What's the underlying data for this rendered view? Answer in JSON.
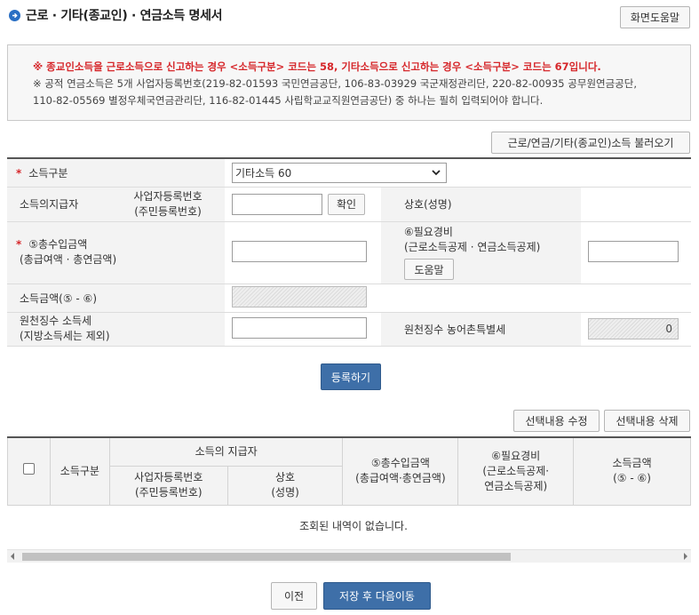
{
  "header": {
    "title": "근로 · 기타(종교인) · 연금소득 명세서",
    "help_button": "화면도움말"
  },
  "notice": {
    "line1": "※ 종교인소득을 근로소득으로 신고하는 경우 <소득구분> 코드는 58, 기타소득으로 신고하는 경우 <소득구분> 코드는 67입니다.",
    "line2": "※ 공적 연금소득은 5개 사업자등록번호(219-82-01593 국민연금공단, 106-83-03929 국군재정관리단, 220-82-00935 공무원연금공단,",
    "line3": "110-82-05569 별정우체국연금관리단, 116-82-01445 사립학교교직원연금공단) 중 하나는 필히 입력되어야 합니다."
  },
  "load_button": "근로/연금/기타(종교인)소득 불러오기",
  "form": {
    "income_type_label": "소득구분",
    "income_type_value": "기타소득 60",
    "payer_label": "소득의지급자",
    "bizno_label_1": "사업자등록번호",
    "bizno_label_2": "(주민등록번호)",
    "bizno_value": "",
    "confirm_button": "확인",
    "company_label": "상호(성명)",
    "company_value": "",
    "gross_label_1": "⑤총수입금액",
    "gross_label_2": "(총급여액 · 총연금액)",
    "gross_value": "",
    "expense_label_1": "⑥필요경비",
    "expense_label_2": "(근로소득공제 · 연금소득공제)",
    "expense_help_button": "도움말",
    "expense_value": "",
    "income_amount_label": "소득금액(⑤ - ⑥)",
    "income_amount_value": "",
    "withholding_label_1": "원천징수 소득세",
    "withholding_label_2": "(지방소득세는 제외)",
    "withholding_value": "",
    "rural_tax_label": "원천징수 농어촌특별세",
    "rural_tax_value": "0"
  },
  "register_button": "등록하기",
  "edit_button": "선택내용 수정",
  "delete_button": "선택내용 삭제",
  "grid": {
    "col_income_type": "소득구분",
    "col_payer": "소득의 지급자",
    "col_bizno_1": "사업자등록번호",
    "col_bizno_2": "(주민등록번호)",
    "col_company_1": "상호",
    "col_company_2": "(성명)",
    "col_gross_1": "⑤총수입금액",
    "col_gross_2": "(총급여액·총연금액)",
    "col_expense_1": "⑥필요경비",
    "col_expense_2": "(근로소득공제·",
    "col_expense_3": "연금소득공제)",
    "col_income_1": "소득금액",
    "col_income_2": "(⑤ - ⑥)",
    "empty_message": "조회된 내역이 없습니다."
  },
  "footer": {
    "prev_button": "이전",
    "save_button": "저장 후 다음이동"
  },
  "colors": {
    "accent": "#3e6fa8",
    "required": "#d6272b"
  }
}
